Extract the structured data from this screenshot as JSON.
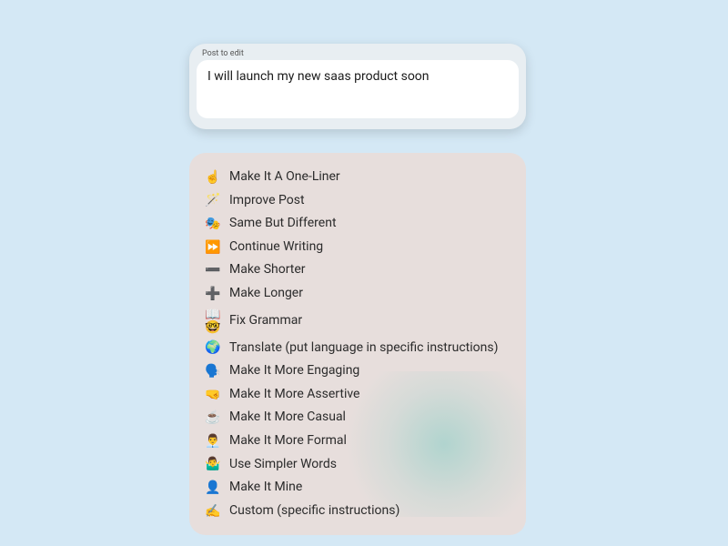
{
  "editor": {
    "label": "Post to edit",
    "value": "I will launch my new saas product soon"
  },
  "actions": [
    {
      "emoji": "☝️",
      "label": "Make It A One-Liner"
    },
    {
      "emoji": "🪄",
      "label": "Improve Post"
    },
    {
      "emoji": "🎭",
      "label": "Same But Different"
    },
    {
      "emoji": "⏩",
      "label": "Continue Writing"
    },
    {
      "emoji": "➖",
      "label": "Make Shorter"
    },
    {
      "emoji": "➕",
      "label": "Make Longer"
    },
    {
      "emoji": "📖🤓",
      "label": "Fix Grammar"
    },
    {
      "emoji": "🌍",
      "label": "Translate (put language in specific instructions)"
    },
    {
      "emoji": "🗣️",
      "label": "Make It More Engaging"
    },
    {
      "emoji": "🤜",
      "label": "Make It More Assertive"
    },
    {
      "emoji": "☕",
      "label": "Make It More Casual"
    },
    {
      "emoji": "👨‍💼",
      "label": "Make It More Formal"
    },
    {
      "emoji": "🤷‍♂️",
      "label": "Use Simpler Words"
    },
    {
      "emoji": "👤",
      "label": "Make It Mine"
    },
    {
      "emoji": "✍️",
      "label": "Custom (specific instructions)"
    }
  ]
}
